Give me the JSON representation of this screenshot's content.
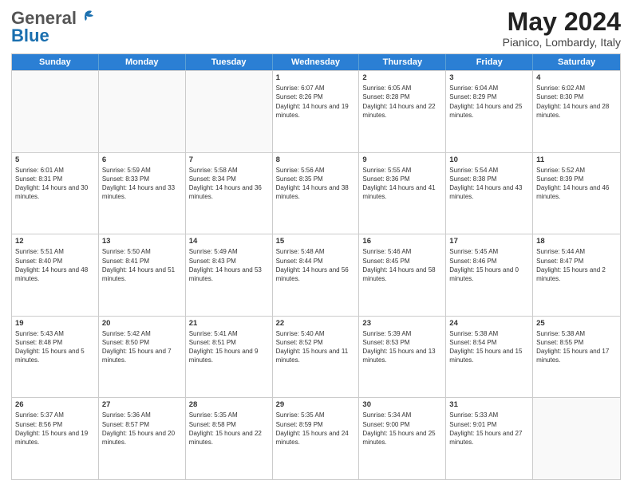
{
  "header": {
    "logo_general": "General",
    "logo_blue": "Blue",
    "title": "May 2024",
    "location": "Pianico, Lombardy, Italy"
  },
  "days_of_week": [
    "Sunday",
    "Monday",
    "Tuesday",
    "Wednesday",
    "Thursday",
    "Friday",
    "Saturday"
  ],
  "weeks": [
    [
      {
        "day": "",
        "sunrise": "",
        "sunset": "",
        "daylight": ""
      },
      {
        "day": "",
        "sunrise": "",
        "sunset": "",
        "daylight": ""
      },
      {
        "day": "",
        "sunrise": "",
        "sunset": "",
        "daylight": ""
      },
      {
        "day": "1",
        "sunrise": "Sunrise: 6:07 AM",
        "sunset": "Sunset: 8:26 PM",
        "daylight": "Daylight: 14 hours and 19 minutes."
      },
      {
        "day": "2",
        "sunrise": "Sunrise: 6:05 AM",
        "sunset": "Sunset: 8:28 PM",
        "daylight": "Daylight: 14 hours and 22 minutes."
      },
      {
        "day": "3",
        "sunrise": "Sunrise: 6:04 AM",
        "sunset": "Sunset: 8:29 PM",
        "daylight": "Daylight: 14 hours and 25 minutes."
      },
      {
        "day": "4",
        "sunrise": "Sunrise: 6:02 AM",
        "sunset": "Sunset: 8:30 PM",
        "daylight": "Daylight: 14 hours and 28 minutes."
      }
    ],
    [
      {
        "day": "5",
        "sunrise": "Sunrise: 6:01 AM",
        "sunset": "Sunset: 8:31 PM",
        "daylight": "Daylight: 14 hours and 30 minutes."
      },
      {
        "day": "6",
        "sunrise": "Sunrise: 5:59 AM",
        "sunset": "Sunset: 8:33 PM",
        "daylight": "Daylight: 14 hours and 33 minutes."
      },
      {
        "day": "7",
        "sunrise": "Sunrise: 5:58 AM",
        "sunset": "Sunset: 8:34 PM",
        "daylight": "Daylight: 14 hours and 36 minutes."
      },
      {
        "day": "8",
        "sunrise": "Sunrise: 5:56 AM",
        "sunset": "Sunset: 8:35 PM",
        "daylight": "Daylight: 14 hours and 38 minutes."
      },
      {
        "day": "9",
        "sunrise": "Sunrise: 5:55 AM",
        "sunset": "Sunset: 8:36 PM",
        "daylight": "Daylight: 14 hours and 41 minutes."
      },
      {
        "day": "10",
        "sunrise": "Sunrise: 5:54 AM",
        "sunset": "Sunset: 8:38 PM",
        "daylight": "Daylight: 14 hours and 43 minutes."
      },
      {
        "day": "11",
        "sunrise": "Sunrise: 5:52 AM",
        "sunset": "Sunset: 8:39 PM",
        "daylight": "Daylight: 14 hours and 46 minutes."
      }
    ],
    [
      {
        "day": "12",
        "sunrise": "Sunrise: 5:51 AM",
        "sunset": "Sunset: 8:40 PM",
        "daylight": "Daylight: 14 hours and 48 minutes."
      },
      {
        "day": "13",
        "sunrise": "Sunrise: 5:50 AM",
        "sunset": "Sunset: 8:41 PM",
        "daylight": "Daylight: 14 hours and 51 minutes."
      },
      {
        "day": "14",
        "sunrise": "Sunrise: 5:49 AM",
        "sunset": "Sunset: 8:43 PM",
        "daylight": "Daylight: 14 hours and 53 minutes."
      },
      {
        "day": "15",
        "sunrise": "Sunrise: 5:48 AM",
        "sunset": "Sunset: 8:44 PM",
        "daylight": "Daylight: 14 hours and 56 minutes."
      },
      {
        "day": "16",
        "sunrise": "Sunrise: 5:46 AM",
        "sunset": "Sunset: 8:45 PM",
        "daylight": "Daylight: 14 hours and 58 minutes."
      },
      {
        "day": "17",
        "sunrise": "Sunrise: 5:45 AM",
        "sunset": "Sunset: 8:46 PM",
        "daylight": "Daylight: 15 hours and 0 minutes."
      },
      {
        "day": "18",
        "sunrise": "Sunrise: 5:44 AM",
        "sunset": "Sunset: 8:47 PM",
        "daylight": "Daylight: 15 hours and 2 minutes."
      }
    ],
    [
      {
        "day": "19",
        "sunrise": "Sunrise: 5:43 AM",
        "sunset": "Sunset: 8:48 PM",
        "daylight": "Daylight: 15 hours and 5 minutes."
      },
      {
        "day": "20",
        "sunrise": "Sunrise: 5:42 AM",
        "sunset": "Sunset: 8:50 PM",
        "daylight": "Daylight: 15 hours and 7 minutes."
      },
      {
        "day": "21",
        "sunrise": "Sunrise: 5:41 AM",
        "sunset": "Sunset: 8:51 PM",
        "daylight": "Daylight: 15 hours and 9 minutes."
      },
      {
        "day": "22",
        "sunrise": "Sunrise: 5:40 AM",
        "sunset": "Sunset: 8:52 PM",
        "daylight": "Daylight: 15 hours and 11 minutes."
      },
      {
        "day": "23",
        "sunrise": "Sunrise: 5:39 AM",
        "sunset": "Sunset: 8:53 PM",
        "daylight": "Daylight: 15 hours and 13 minutes."
      },
      {
        "day": "24",
        "sunrise": "Sunrise: 5:38 AM",
        "sunset": "Sunset: 8:54 PM",
        "daylight": "Daylight: 15 hours and 15 minutes."
      },
      {
        "day": "25",
        "sunrise": "Sunrise: 5:38 AM",
        "sunset": "Sunset: 8:55 PM",
        "daylight": "Daylight: 15 hours and 17 minutes."
      }
    ],
    [
      {
        "day": "26",
        "sunrise": "Sunrise: 5:37 AM",
        "sunset": "Sunset: 8:56 PM",
        "daylight": "Daylight: 15 hours and 19 minutes."
      },
      {
        "day": "27",
        "sunrise": "Sunrise: 5:36 AM",
        "sunset": "Sunset: 8:57 PM",
        "daylight": "Daylight: 15 hours and 20 minutes."
      },
      {
        "day": "28",
        "sunrise": "Sunrise: 5:35 AM",
        "sunset": "Sunset: 8:58 PM",
        "daylight": "Daylight: 15 hours and 22 minutes."
      },
      {
        "day": "29",
        "sunrise": "Sunrise: 5:35 AM",
        "sunset": "Sunset: 8:59 PM",
        "daylight": "Daylight: 15 hours and 24 minutes."
      },
      {
        "day": "30",
        "sunrise": "Sunrise: 5:34 AM",
        "sunset": "Sunset: 9:00 PM",
        "daylight": "Daylight: 15 hours and 25 minutes."
      },
      {
        "day": "31",
        "sunrise": "Sunrise: 5:33 AM",
        "sunset": "Sunset: 9:01 PM",
        "daylight": "Daylight: 15 hours and 27 minutes."
      },
      {
        "day": "",
        "sunrise": "",
        "sunset": "",
        "daylight": ""
      }
    ]
  ]
}
